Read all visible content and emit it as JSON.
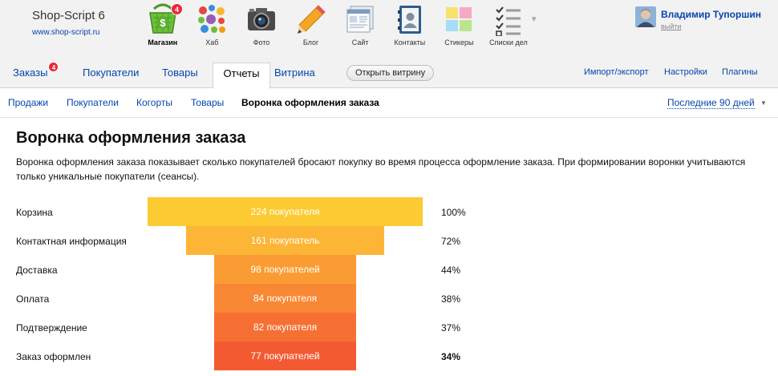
{
  "brand": {
    "name": "Shop-Script 6",
    "url": "www.shop-script.ru"
  },
  "apps": [
    {
      "label": "Магазин",
      "icon": "shop-basket-icon",
      "badge": "4",
      "active": true
    },
    {
      "label": "Хаб",
      "icon": "hub-icon"
    },
    {
      "label": "Фото",
      "icon": "camera-icon"
    },
    {
      "label": "Блог",
      "icon": "pencil-icon"
    },
    {
      "label": "Сайт",
      "icon": "site-icon"
    },
    {
      "label": "Контакты",
      "icon": "contacts-icon"
    },
    {
      "label": "Стикеры",
      "icon": "stickers-icon"
    },
    {
      "label": "Списки дел",
      "icon": "checklist-icon"
    }
  ],
  "user": {
    "name": "Владимир Тупоршин",
    "logout": "выйти"
  },
  "tabs": {
    "orders": {
      "label": "Заказы",
      "badge": "4"
    },
    "customers": {
      "label": "Покупатели"
    },
    "products": {
      "label": "Товары"
    },
    "reports": {
      "label": "Отчеты"
    },
    "storefront": {
      "label": "Витрина"
    },
    "open_storefront": "Открыть витрину",
    "import_export": "Импорт/экспорт",
    "settings": "Настройки",
    "plugins": "Плагины"
  },
  "subnav": {
    "sales": "Продажи",
    "customers": "Покупатели",
    "cohorts": "Когорты",
    "products": "Товары",
    "funnel": "Воронка оформления заказа",
    "period": "Последние 90 дней"
  },
  "page": {
    "title": "Воронка оформления заказа",
    "description": "Воронка оформления заказа показывает сколько покупателей бросают покупку во время процесса оформление заказа. При формировании воронки учитываются только уникальные покупатели (сеансы)."
  },
  "funnel": [
    {
      "stage": "Корзина",
      "count_label": "224 покупателя",
      "percent": "100%",
      "color": "#fccb33"
    },
    {
      "stage": "Контактная информация",
      "count_label": "161 покупатель",
      "percent": "72%",
      "color": "#fcb535"
    },
    {
      "stage": "Доставка",
      "count_label": "98 покупателей",
      "percent": "44%",
      "color": "#fa9c33"
    },
    {
      "stage": "Оплата",
      "count_label": "84 покупателя",
      "percent": "38%",
      "color": "#f88834"
    },
    {
      "stage": "Подтверждение",
      "count_label": "82 покупателя",
      "percent": "37%",
      "color": "#f67034"
    },
    {
      "stage": "Заказ оформлен",
      "count_label": "77 покупателей",
      "percent": "34%",
      "color": "#f45a32"
    }
  ]
}
